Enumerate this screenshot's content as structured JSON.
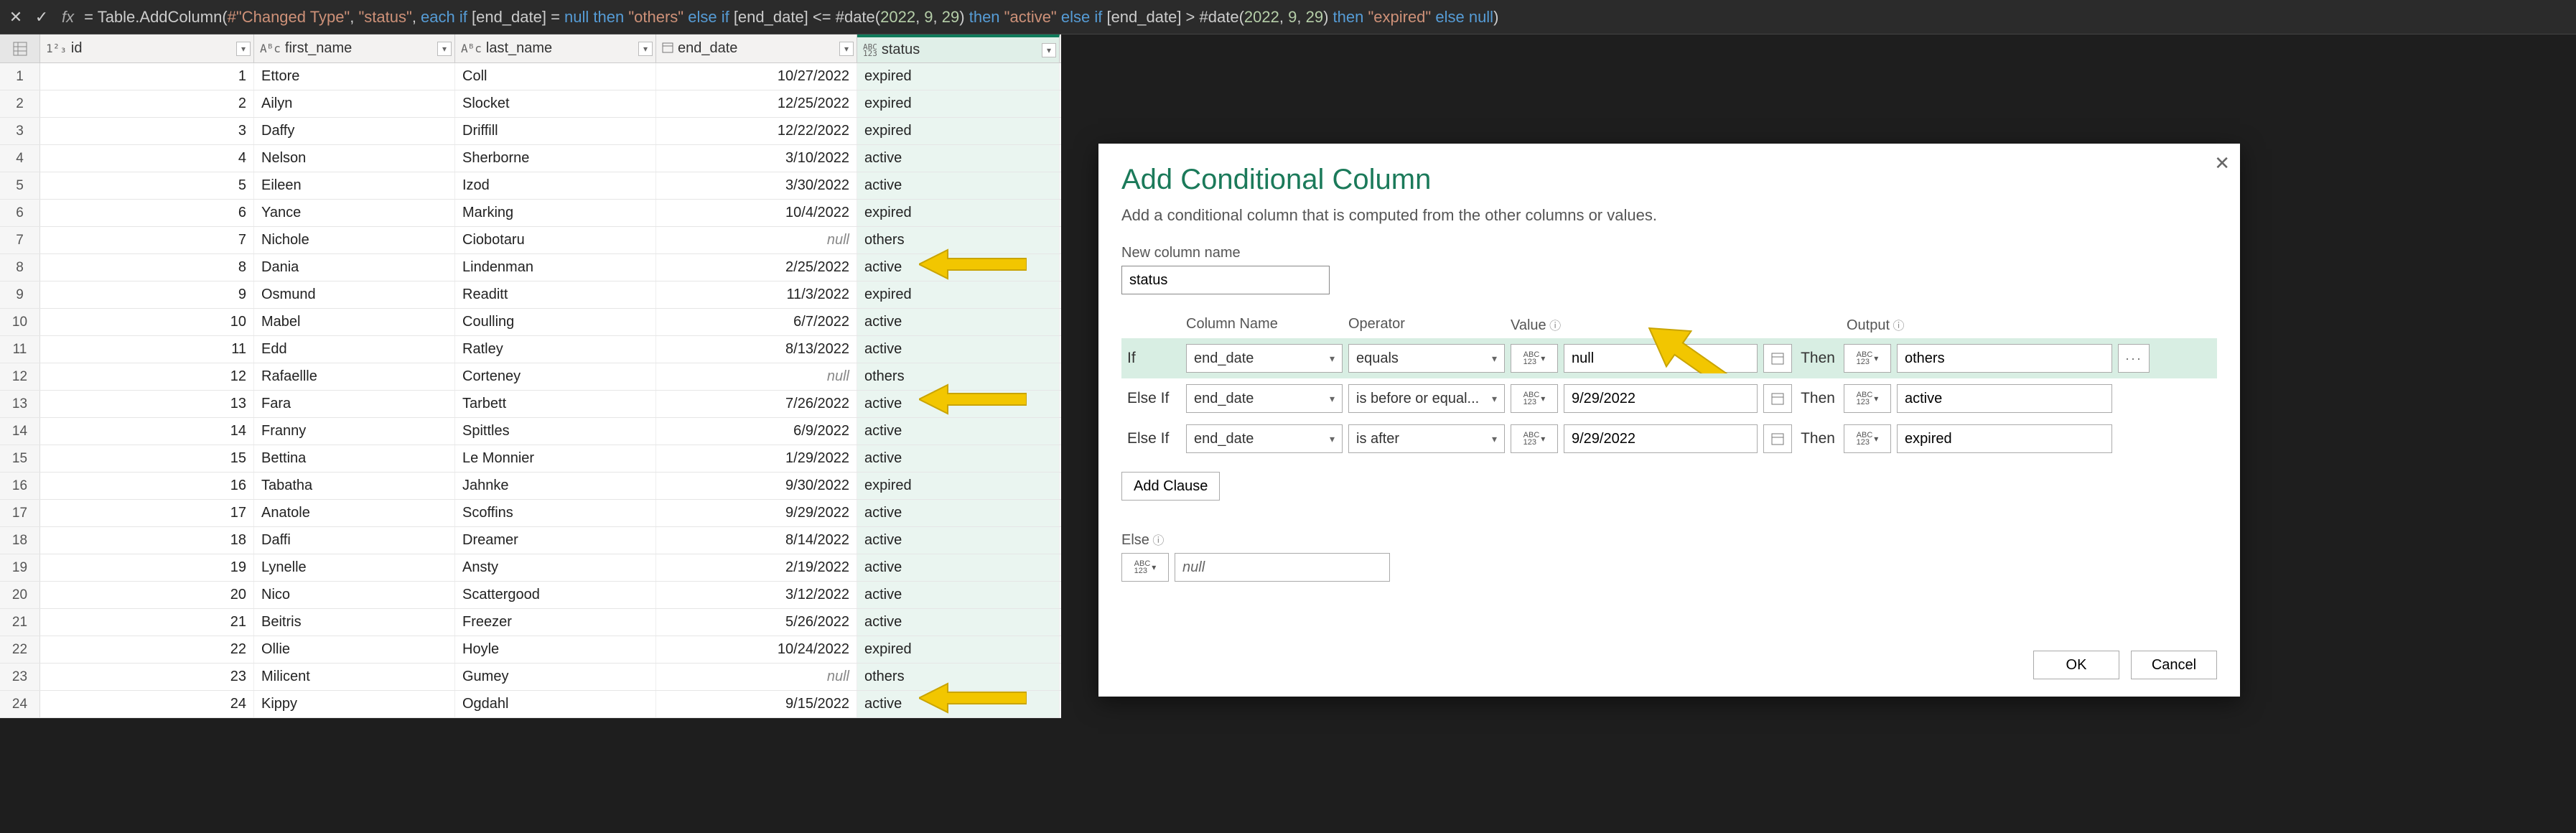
{
  "formula": {
    "raw": "= Table.AddColumn(#\"Changed Type\", \"status\", each if [end_date] = null then \"others\" else if [end_date] <= #date(2022, 9, 29) then \"active\" else if [end_date] > #date(2022, 9, 29) then \"expired\" else null)",
    "tokens": [
      {
        "t": "= ",
        "c": "tok-eq"
      },
      {
        "t": "Table.AddColumn(",
        "c": "tok-fn"
      },
      {
        "t": "#\"Changed Type\"",
        "c": "tok-str"
      },
      {
        "t": ", ",
        "c": "tok-eq"
      },
      {
        "t": "\"status\"",
        "c": "tok-str"
      },
      {
        "t": ", ",
        "c": "tok-eq"
      },
      {
        "t": "each if ",
        "c": "tok-kw"
      },
      {
        "t": "[end_date]",
        "c": "tok-field"
      },
      {
        "t": " = ",
        "c": "tok-eq"
      },
      {
        "t": "null",
        "c": "tok-kw"
      },
      {
        "t": " then ",
        "c": "tok-kw"
      },
      {
        "t": "\"others\"",
        "c": "tok-str"
      },
      {
        "t": " else if ",
        "c": "tok-kw"
      },
      {
        "t": "[end_date]",
        "c": "tok-field"
      },
      {
        "t": " <= ",
        "c": "tok-eq"
      },
      {
        "t": "#date(",
        "c": "tok-fn"
      },
      {
        "t": "2022",
        "c": "tok-num"
      },
      {
        "t": ", ",
        "c": "tok-eq"
      },
      {
        "t": "9",
        "c": "tok-num"
      },
      {
        "t": ", ",
        "c": "tok-eq"
      },
      {
        "t": "29",
        "c": "tok-num"
      },
      {
        "t": ") ",
        "c": "tok-fn"
      },
      {
        "t": "then ",
        "c": "tok-kw"
      },
      {
        "t": "\"active\"",
        "c": "tok-str"
      },
      {
        "t": " else if ",
        "c": "tok-kw"
      },
      {
        "t": "[end_date]",
        "c": "tok-field"
      },
      {
        "t": " > ",
        "c": "tok-eq"
      },
      {
        "t": "#date(",
        "c": "tok-fn"
      },
      {
        "t": "2022",
        "c": "tok-num"
      },
      {
        "t": ", ",
        "c": "tok-eq"
      },
      {
        "t": "9",
        "c": "tok-num"
      },
      {
        "t": ", ",
        "c": "tok-eq"
      },
      {
        "t": "29",
        "c": "tok-num"
      },
      {
        "t": ") ",
        "c": "tok-fn"
      },
      {
        "t": "then ",
        "c": "tok-kw"
      },
      {
        "t": "\"expired\"",
        "c": "tok-str"
      },
      {
        "t": " else ",
        "c": "tok-kw"
      },
      {
        "t": "null",
        "c": "tok-kw"
      },
      {
        "t": ")",
        "c": "tok-fn"
      }
    ]
  },
  "columns": {
    "id": {
      "label": "id",
      "type": "1²₃"
    },
    "first_name": {
      "label": "first_name",
      "type": "AᴮC"
    },
    "last_name": {
      "label": "last_name",
      "type": "AᴮC"
    },
    "end_date": {
      "label": "end_date",
      "type": "📅"
    },
    "status": {
      "label": "status",
      "type": "ABC\n123"
    }
  },
  "rows": [
    {
      "n": 1,
      "id": 1,
      "fn": "Ettore",
      "ln": "Coll",
      "ed": "10/27/2022",
      "st": "expired"
    },
    {
      "n": 2,
      "id": 2,
      "fn": "Ailyn",
      "ln": "Slocket",
      "ed": "12/25/2022",
      "st": "expired"
    },
    {
      "n": 3,
      "id": 3,
      "fn": "Daffy",
      "ln": "Driffill",
      "ed": "12/22/2022",
      "st": "expired"
    },
    {
      "n": 4,
      "id": 4,
      "fn": "Nelson",
      "ln": "Sherborne",
      "ed": "3/10/2022",
      "st": "active"
    },
    {
      "n": 5,
      "id": 5,
      "fn": "Eileen",
      "ln": "Izod",
      "ed": "3/30/2022",
      "st": "active"
    },
    {
      "n": 6,
      "id": 6,
      "fn": "Yance",
      "ln": "Marking",
      "ed": "10/4/2022",
      "st": "expired"
    },
    {
      "n": 7,
      "id": 7,
      "fn": "Nichole",
      "ln": "Ciobotaru",
      "ed": null,
      "st": "others"
    },
    {
      "n": 8,
      "id": 8,
      "fn": "Dania",
      "ln": "Lindenman",
      "ed": "2/25/2022",
      "st": "active"
    },
    {
      "n": 9,
      "id": 9,
      "fn": "Osmund",
      "ln": "Readitt",
      "ed": "11/3/2022",
      "st": "expired"
    },
    {
      "n": 10,
      "id": 10,
      "fn": "Mabel",
      "ln": "Coulling",
      "ed": "6/7/2022",
      "st": "active"
    },
    {
      "n": 11,
      "id": 11,
      "fn": "Edd",
      "ln": "Ratley",
      "ed": "8/13/2022",
      "st": "active"
    },
    {
      "n": 12,
      "id": 12,
      "fn": "Rafaellle",
      "ln": "Corteney",
      "ed": null,
      "st": "others"
    },
    {
      "n": 13,
      "id": 13,
      "fn": "Fara",
      "ln": "Tarbett",
      "ed": "7/26/2022",
      "st": "active"
    },
    {
      "n": 14,
      "id": 14,
      "fn": "Franny",
      "ln": "Spittles",
      "ed": "6/9/2022",
      "st": "active"
    },
    {
      "n": 15,
      "id": 15,
      "fn": "Bettina",
      "ln": "Le Monnier",
      "ed": "1/29/2022",
      "st": "active"
    },
    {
      "n": 16,
      "id": 16,
      "fn": "Tabatha",
      "ln": "Jahnke",
      "ed": "9/30/2022",
      "st": "expired"
    },
    {
      "n": 17,
      "id": 17,
      "fn": "Anatole",
      "ln": "Scoffins",
      "ed": "9/29/2022",
      "st": "active"
    },
    {
      "n": 18,
      "id": 18,
      "fn": "Daffi",
      "ln": "Dreamer",
      "ed": "8/14/2022",
      "st": "active"
    },
    {
      "n": 19,
      "id": 19,
      "fn": "Lynelle",
      "ln": "Ansty",
      "ed": "2/19/2022",
      "st": "active"
    },
    {
      "n": 20,
      "id": 20,
      "fn": "Nico",
      "ln": "Scattergood",
      "ed": "3/12/2022",
      "st": "active"
    },
    {
      "n": 21,
      "id": 21,
      "fn": "Beitris",
      "ln": "Freezer",
      "ed": "5/26/2022",
      "st": "active"
    },
    {
      "n": 22,
      "id": 22,
      "fn": "Ollie",
      "ln": "Hoyle",
      "ed": "10/24/2022",
      "st": "expired"
    },
    {
      "n": 23,
      "id": 23,
      "fn": "Milicent",
      "ln": "Gumey",
      "ed": null,
      "st": "others"
    },
    {
      "n": 24,
      "id": 24,
      "fn": "Kippy",
      "ln": "Ogdahl",
      "ed": "9/15/2022",
      "st": "active"
    }
  ],
  "null_label": "null",
  "dialog": {
    "title": "Add Conditional Column",
    "subtitle": "Add a conditional column that is computed from the other columns or values.",
    "new_col_label": "New column name",
    "new_col_value": "status",
    "headers": {
      "col": "Column Name",
      "op": "Operator",
      "val": "Value",
      "out": "Output"
    },
    "then_label": "Then",
    "clauses": [
      {
        "kw": "If",
        "col": "end_date",
        "op": "equals",
        "val": "null",
        "out": "others",
        "selected": true
      },
      {
        "kw": "Else If",
        "col": "end_date",
        "op": "is before or equal...",
        "val": "9/29/2022",
        "out": "active",
        "selected": false
      },
      {
        "kw": "Else If",
        "col": "end_date",
        "op": "is after",
        "val": "9/29/2022",
        "out": "expired",
        "selected": false
      }
    ],
    "add_clause": "Add Clause",
    "else_label": "Else",
    "else_value": "null",
    "ok": "OK",
    "cancel": "Cancel",
    "type_pill": "ABC\n123"
  }
}
